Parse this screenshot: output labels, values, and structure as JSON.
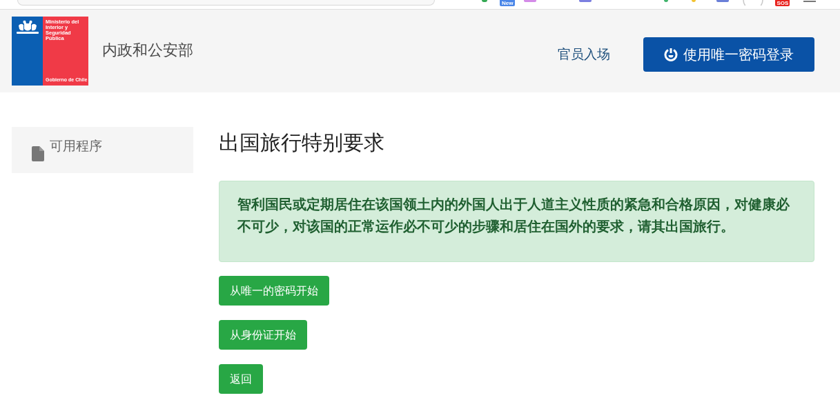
{
  "browser_toolbar": {
    "badges": [
      {
        "label": "New",
        "color": "#4a86e8"
      },
      {
        "label": "SOS",
        "color": "#e8231f"
      }
    ]
  },
  "header": {
    "logo": {
      "name": "Ministerio del Interior y Seguridad Pública",
      "footer": "Gobierno de Chile"
    },
    "title": "内政和公安部",
    "nav_link": "官员入场",
    "login_button": "使用唯一密码登录"
  },
  "sidebar": {
    "items": [
      {
        "label": "可用程序"
      }
    ]
  },
  "main": {
    "title": "出国旅行特别要求",
    "notice": "智利国民或定期居住在该国领土内的外国人出于人道主义性质的紧急和合格原因，对健康必不可少，对该国的正常运作必不可少的步骤和居住在国外的要求，请其出国旅行。",
    "buttons": [
      {
        "label": "从唯一的密码开始"
      },
      {
        "label": "从身份证开始"
      },
      {
        "label": "返回"
      }
    ]
  }
}
